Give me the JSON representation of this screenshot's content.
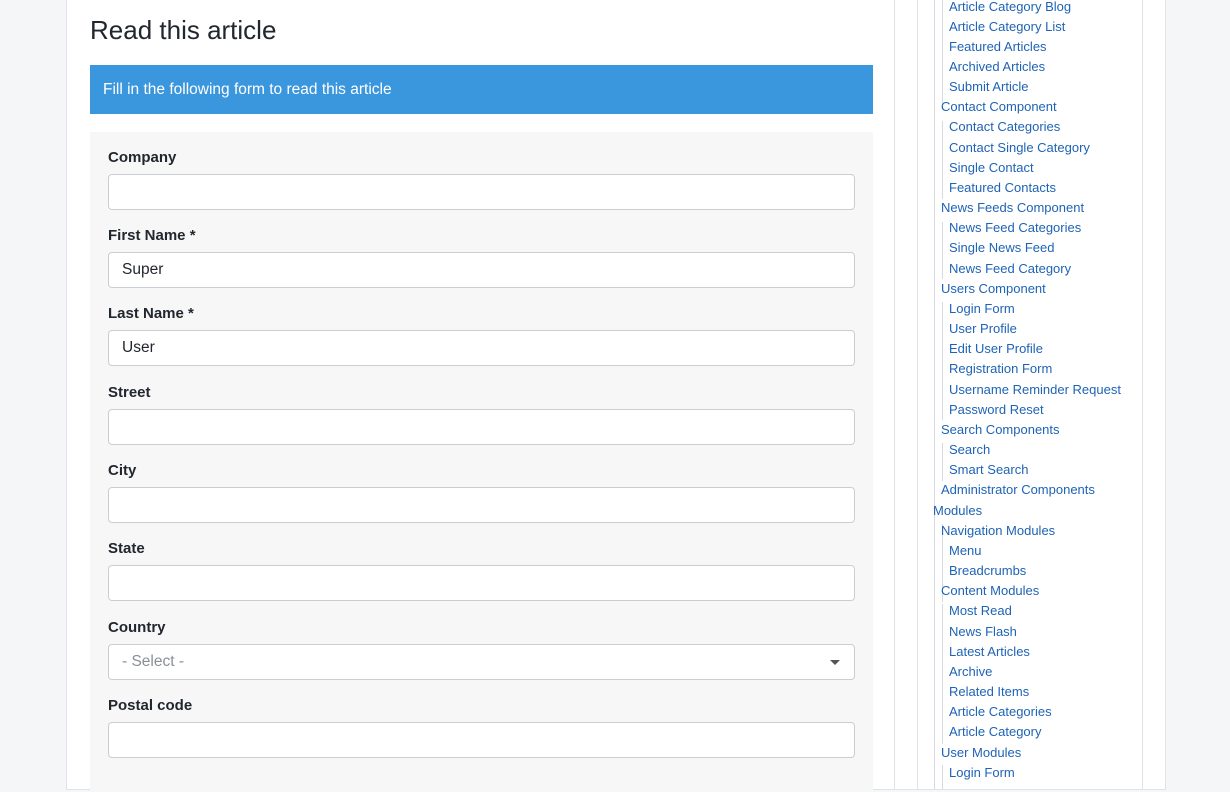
{
  "article": {
    "title": "Read this article",
    "banner": "Fill in the following form to read this article"
  },
  "form": {
    "company": {
      "label": "Company",
      "value": ""
    },
    "first_name": {
      "label": "First Name *",
      "value": "Super"
    },
    "last_name": {
      "label": "Last Name *",
      "value": "User"
    },
    "street": {
      "label": "Street",
      "value": ""
    },
    "city": {
      "label": "City",
      "value": ""
    },
    "state": {
      "label": "State",
      "value": ""
    },
    "country": {
      "label": "Country",
      "selected": "- Select -"
    },
    "postal_code": {
      "label": "Postal code",
      "value": ""
    }
  },
  "sidebar": {
    "items": [
      "Article Category Blog",
      "Article Category List",
      "Featured Articles",
      "Archived Articles",
      "Submit Article",
      "Contact Component",
      "Contact Categories",
      "Contact Single Category",
      "Single Contact",
      "Featured Contacts",
      "News Feeds Component",
      "News Feed Categories",
      "Single News Feed",
      "News Feed Category",
      "Users Component",
      "Login Form",
      "User Profile",
      "Edit User Profile",
      "Registration Form",
      "Username Reminder Request",
      "Password Reset",
      "Search Components",
      "Search",
      "Smart Search",
      "Administrator Components",
      "Modules",
      "Navigation Modules",
      "Menu",
      "Breadcrumbs",
      "Content Modules",
      "Most Read",
      "News Flash",
      "Latest Articles",
      "Archive",
      "Related Items",
      "Article Categories",
      "Article Category",
      "User Modules",
      "Login Form"
    ]
  },
  "colors": {
    "banner": "#3a96dd",
    "link": "#1e63b5"
  }
}
